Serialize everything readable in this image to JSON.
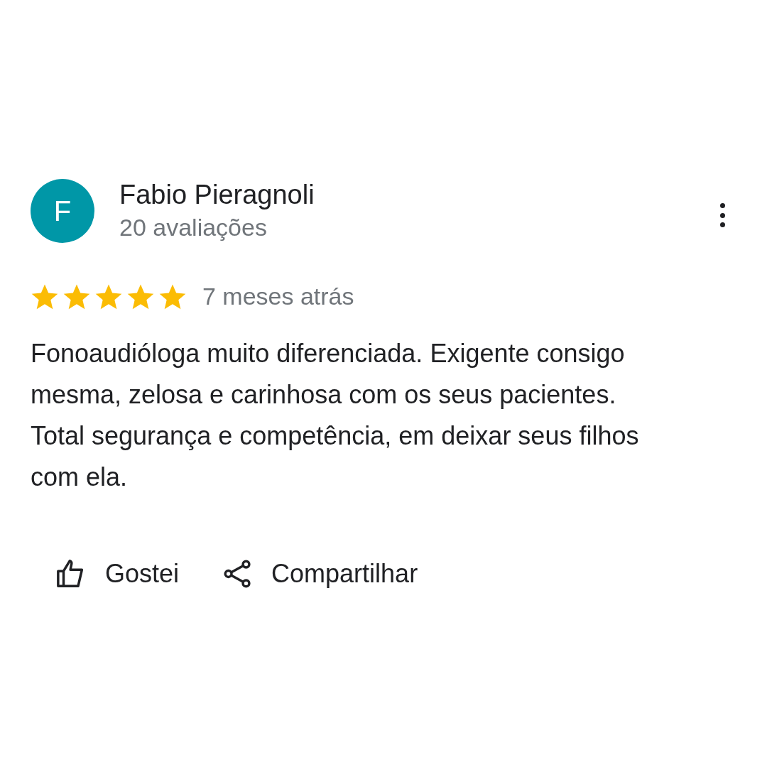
{
  "review": {
    "avatar_letter": "F",
    "author": "Fabio Pieragnoli",
    "author_meta": "20 avaliações",
    "stars": 5,
    "date": "7 meses atrás",
    "text": "Fonoaudióloga muito diferenciada. Exigente consigo mesma, zelosa e carinhosa com os seus pacientes. Total segurança e competência, em deixar seus filhos com ela."
  },
  "actions": [
    {
      "kind": "like",
      "label": "Gostei"
    },
    {
      "kind": "share",
      "label": "Compartilhar"
    }
  ]
}
